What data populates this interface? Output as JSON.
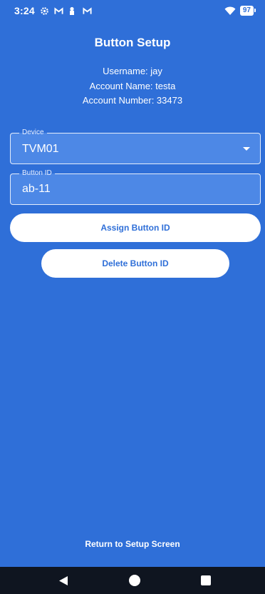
{
  "status_bar": {
    "time": "3:24",
    "battery": "97",
    "icons": [
      "settings-icon",
      "gmail-icon",
      "keyhole-icon",
      "gmail-icon",
      "wifi-icon",
      "battery-icon"
    ]
  },
  "header": {
    "title": "Button Setup"
  },
  "account": {
    "username_line": "Username: jay",
    "account_name_line": "Account Name: testa",
    "account_number_line": "Account Number: 33473"
  },
  "device_field": {
    "label": "Device",
    "value": "TVM01"
  },
  "button_id_field": {
    "label": "Button ID",
    "value": "ab-11"
  },
  "actions": {
    "assign": "Assign Button ID",
    "delete": "Delete Button ID",
    "return": "Return to Setup Screen"
  },
  "colors": {
    "background": "#2f6fd8",
    "field_fill": "#4d88e6",
    "button_bg": "#ffffff",
    "button_text": "#2f6fd8",
    "nav_bar": "#0f1520"
  }
}
